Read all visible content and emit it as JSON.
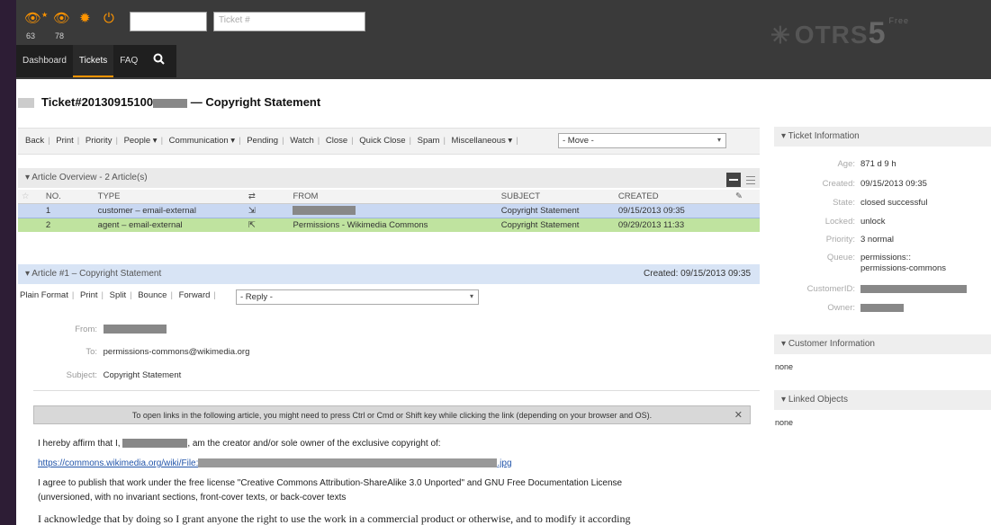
{
  "header": {
    "watched_count": "63",
    "responsible_count": "78",
    "search_placeholder": "Ticket #",
    "logo_text": "OTRS",
    "logo_version": "5",
    "logo_edition": "Free"
  },
  "nav": {
    "items": [
      "Dashboard",
      "Tickets",
      "FAQ"
    ],
    "active": "Tickets"
  },
  "ticket": {
    "title_prefix": "Ticket#20130915100",
    "title_suffix": "— Copyright Statement"
  },
  "actions": {
    "items": [
      "Back",
      "Print",
      "Priority",
      "People ▾",
      "Communication ▾",
      "Pending",
      "Watch",
      "Close",
      "Quick Close",
      "Spam",
      "Miscellaneous ▾"
    ],
    "move_select": "- Move -"
  },
  "overview": {
    "title": "Article Overview - 2 Article(s)",
    "columns": [
      "NO.",
      "TYPE",
      "⇄",
      "FROM",
      "SUBJECT",
      "CREATED",
      "✎"
    ],
    "rows": [
      {
        "no": "1",
        "type": "customer – email-external",
        "from": "",
        "subject": "Copyright Statement",
        "created": "09/15/2013 09:35"
      },
      {
        "no": "2",
        "type": "agent – email-external",
        "from": "Permissions - Wikimedia Commons",
        "subject": "Copyright Statement",
        "created": "09/29/2013 11:33"
      }
    ]
  },
  "article": {
    "title": "Article #1 – Copyright Statement",
    "created": "Created: 09/15/2013 09:35",
    "links": [
      "Plain Format",
      "Print",
      "Split",
      "Bounce",
      "Forward"
    ],
    "reply_select": "- Reply -",
    "from_label": "From:",
    "to_label": "To:",
    "to_value": "permissions-commons@wikimedia.org",
    "subject_label": "Subject:",
    "subject_value": "Copyright Statement",
    "link_note": "To open links in the following article, you might need to press Ctrl or Cmd or Shift key while clicking the link (depending on your browser and OS).",
    "close_symbol": "✕",
    "body_line1a": "I hereby affirm that I,",
    "body_line1b": ", am the creator and/or sole owner of the exclusive copyright of:",
    "body_link_a": "https://commons.wikimedia.org/wiki/File:",
    "body_link_b": ".jpg",
    "body_line3": "I agree to publish that work under the free license \"Creative Commons Attribution-ShareAlike 3.0 Unported\" and GNU Free Documentation License",
    "body_line4": "(unversioned, with no invariant sections, front-cover texts, or back-cover texts",
    "body_line5": "I acknowledge that by doing so I grant anyone the right to use the work in a commercial product or otherwise, and to modify it according"
  },
  "ticket_info": {
    "title": "Ticket Information",
    "rows": [
      {
        "label": "Age:",
        "value": "871 d 9 h"
      },
      {
        "label": "Created:",
        "value": "09/15/2013 09:35"
      },
      {
        "label": "State:",
        "value": "closed successful"
      },
      {
        "label": "Locked:",
        "value": "unlock"
      },
      {
        "label": "Priority:",
        "value": "3 normal"
      },
      {
        "label": "Queue:",
        "value": "permissions::"
      },
      {
        "label": "",
        "value": "permissions-commons"
      },
      {
        "label": "CustomerID:",
        "value": ""
      },
      {
        "label": "Owner:",
        "value": ""
      }
    ]
  },
  "customer_info": {
    "title": "Customer Information",
    "value": "none"
  },
  "linked_objects": {
    "title": "Linked Objects",
    "value": "none"
  },
  "colors": {
    "accent": "#ff9500",
    "header_bg": "#3a3a3a",
    "row1_bg": "#c9d8f2",
    "row2_bg": "#bfe39f"
  }
}
